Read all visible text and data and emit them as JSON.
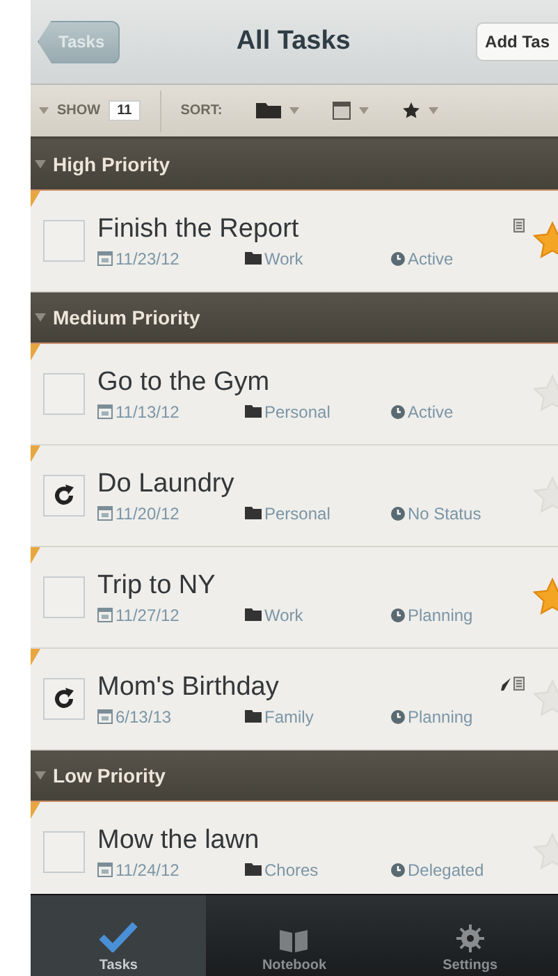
{
  "nav": {
    "back": "Tasks",
    "title": "All Tasks",
    "action": "Add Tas"
  },
  "toolbar": {
    "show_label": "SHOW",
    "show_count": "11",
    "sort_label": "SORT:"
  },
  "groups": [
    {
      "title": "High Priority",
      "expanded": true,
      "tasks": [
        {
          "kind": "checkbox",
          "checked": false,
          "title": "Finish the Report",
          "date": "11/23/12",
          "folder": "Work",
          "status": "Active",
          "starred": true,
          "note": true,
          "edit": false
        }
      ]
    },
    {
      "title": "Medium Priority",
      "expanded": true,
      "tasks": [
        {
          "kind": "checkbox",
          "checked": false,
          "title": "Go to the Gym",
          "date": "11/13/12",
          "folder": "Personal",
          "status": "Active",
          "starred": false,
          "note": false,
          "edit": false
        },
        {
          "kind": "repeat",
          "title": "Do Laundry",
          "date": "11/20/12",
          "folder": "Personal",
          "status": "No Status",
          "starred": false,
          "note": false,
          "edit": false
        },
        {
          "kind": "checkbox",
          "checked": false,
          "title": "Trip to NY",
          "date": "11/27/12",
          "folder": "Work",
          "status": "Planning",
          "starred": true,
          "note": false,
          "edit": false
        },
        {
          "kind": "repeat",
          "title": "Mom's Birthday",
          "date": "6/13/13",
          "folder": "Family",
          "status": "Planning",
          "starred": false,
          "note": true,
          "edit": true
        }
      ]
    },
    {
      "title": "Low Priority",
      "expanded": true,
      "tasks": [
        {
          "kind": "checkbox",
          "checked": false,
          "title": "Mow the lawn",
          "date": "11/24/12",
          "folder": "Chores",
          "status": "Delegated",
          "starred": false,
          "note": false,
          "edit": false
        }
      ]
    }
  ],
  "tabs": [
    {
      "label": "Tasks",
      "selected": true
    },
    {
      "label": "Notebook",
      "selected": false
    },
    {
      "label": "Settings",
      "selected": false
    }
  ]
}
